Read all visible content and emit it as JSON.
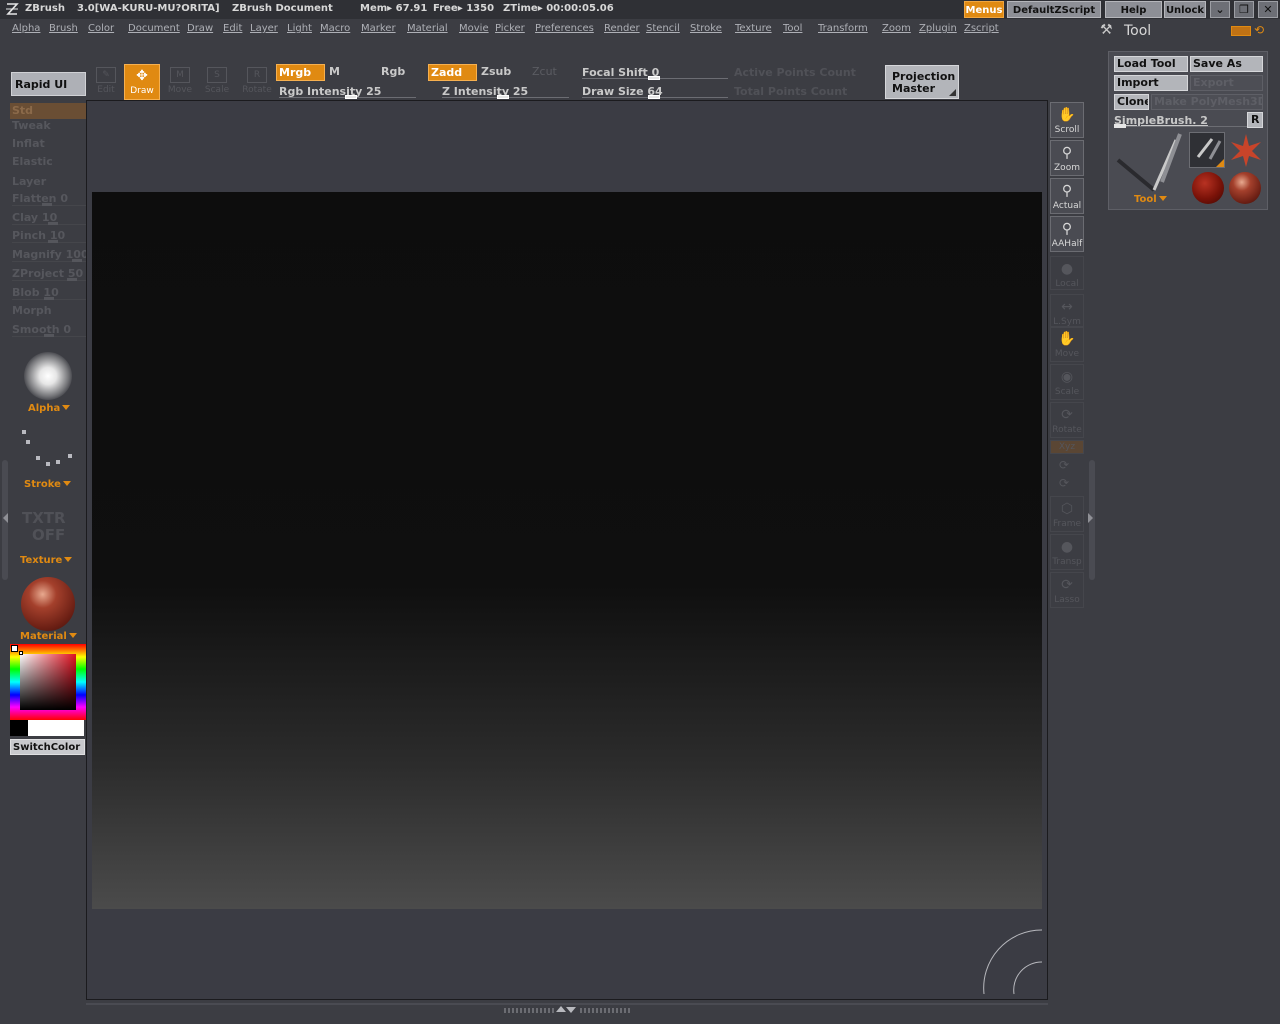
{
  "titlebar": {
    "app": "ZBrush",
    "version": "3.0[WA-KURU-MU?ORITA]",
    "document": "ZBrush Document",
    "mem": "Mem▸ 67.91",
    "free": "Free▸ 1350",
    "ztime": "ZTime▸ 00:00:05.06",
    "menus": "Menus",
    "default_zscript": "DefaultZScript",
    "help": "Help",
    "unlock": "Unlock"
  },
  "menu": [
    "Alpha",
    "Brush",
    "Color",
    "Document",
    "Draw",
    "Edit",
    "Layer",
    "Light",
    "Macro",
    "Marker",
    "Material",
    "Movie",
    "Picker",
    "Preferences",
    "Render",
    "Stencil",
    "Stroke",
    "Texture",
    "Tool",
    "Transform",
    "Zoom",
    "Zplugin",
    "Zscript"
  ],
  "shelf": {
    "rapid_ui": "Rapid UI",
    "edit": "Edit",
    "draw": "Draw",
    "move": "Move",
    "scale": "Scale",
    "rotate": "Rotate",
    "mrgb": "Mrgb",
    "m": "M",
    "rgb": "Rgb",
    "rgb_intensity": "Rgb  Intensity  25",
    "rgb_intensity_value": 25,
    "zadd": "Zadd",
    "zsub": "Zsub",
    "zcut": "Zcut",
    "z_intensity": "Z  Intensity  25",
    "z_intensity_value": 25,
    "focal_shift": "Focal  Shift  0",
    "focal_shift_value": 0,
    "draw_size": "Draw  Size  64",
    "draw_size_value": 64,
    "active_points": "Active  Points  Count",
    "total_points": "Total  Points  Count",
    "projection_master": [
      "Projection",
      "Master"
    ]
  },
  "left_tray": {
    "brushes": [
      "Std",
      "Tweak",
      "Inflat",
      "Elastic",
      "Layer",
      "Flatten 0",
      "Clay 10",
      "Pinch 10",
      "Magnify 100",
      "ZProject 50",
      "Blob 10",
      "Morph",
      "Smooth 0"
    ],
    "alpha": "Alpha",
    "stroke": "Stroke",
    "texture_placeholder": [
      "TXTR",
      "OFF"
    ],
    "texture": "Texture",
    "material": "Material",
    "switch_color": "SwitchColor"
  },
  "right_shelf": [
    "Scroll",
    "Zoom",
    "Actual",
    "AAHalf",
    "Local",
    "L.Sym",
    "Move",
    "Scale",
    "Rotate",
    "Xyz",
    "",
    "",
    "Frame",
    "Transp",
    "Lasso"
  ],
  "tool_panel": {
    "title": "Tool",
    "load_tool": "Load Tool",
    "save_as": "Save As",
    "import": "Import",
    "export": "Export",
    "clone": "Clone",
    "make_polymesh": "Make PolyMesh3D",
    "current_tool": "SimpleBrush. 2",
    "r_button": "R",
    "tool_caret": "Tool"
  },
  "colors": {
    "accent": "#e08a12",
    "background": "#3c3d43",
    "canvas_top": "#0d0d0d",
    "canvas_bottom": "#4b4b4b"
  }
}
